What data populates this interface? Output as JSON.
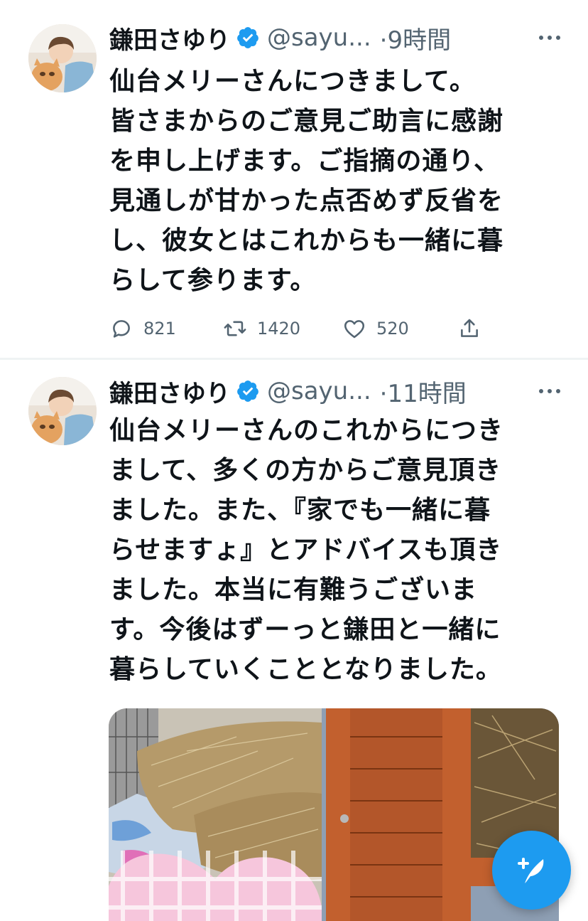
{
  "tweets": [
    {
      "author_name": "鎌田さゆり",
      "handle": "@sayu...",
      "time": "·9時間",
      "text": "仙台メリーさんにつきまして。\n皆さまからのご意見ご助言に感謝\nを申し上げます。ご指摘の通り、\n見通しが甘かった点否めず反省を\nし、彼女とはこれからも一緒に暮\nらして参ります。",
      "stats": {
        "replies": "821",
        "retweets": "1420",
        "likes": "520"
      }
    },
    {
      "author_name": "鎌田さゆり",
      "handle": "@sayu...",
      "time": "·11時間",
      "text": "仙台メリーさんのこれからにつき\nまして、多くの方からご意見頂き\nました。また、『家でも一緒に暮\nらせますょ』とアドバイスも頂き\nました。本当に有難うございま\nす。今後はずーっと鎌田と一緒に\n暮らしていくこととなりました。"
    }
  ],
  "icons": {
    "verified": "verified-badge-icon",
    "more": "more-horizontal-icon",
    "reply": "reply-bubble-icon",
    "retweet": "retweet-icon",
    "like": "heart-icon",
    "share": "share-icon",
    "compose": "compose-tweet-icon"
  },
  "colors": {
    "accent": "#1d9bf0",
    "text_primary": "#0f1419",
    "text_secondary": "#536471",
    "divider": "#eff3f4"
  }
}
